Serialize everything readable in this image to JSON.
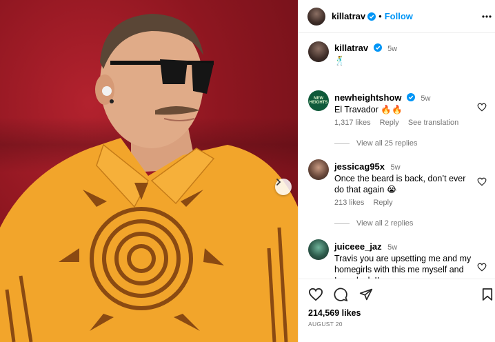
{
  "post": {
    "username": "killatrav",
    "follow_label": "Follow",
    "likes": "214,569 likes",
    "date": "AUGUST 20"
  },
  "caption": {
    "username": "killatrav",
    "time": "5w",
    "text": "🕺"
  },
  "comments": [
    {
      "username": "newheightshow",
      "time": "5w",
      "text": "El Travador 🔥🔥",
      "likes": "1,317 likes",
      "reply_label": "Reply",
      "translate_label": "See translation",
      "view_replies": "View all 25 replies",
      "avatar_text": "NEW HEIGHTS"
    },
    {
      "username": "jessicag95x",
      "time": "5w",
      "text": "Once the beard is back, don’t ever do that again 😭",
      "likes": "213 likes",
      "reply_label": "Reply",
      "view_replies": "View all 2 replies"
    },
    {
      "username": "juiceee_jaz",
      "time": "5w",
      "text": "Travis you are upsetting me and my homegirls with this me myself and Irene look !!"
    }
  ],
  "icons": [
    "verified-badge",
    "heart-icon",
    "comment-icon",
    "share-icon",
    "save-icon",
    "chevron-right-icon"
  ],
  "colors": {
    "follow": "#0095f6",
    "verified": "#0095f6",
    "shirt": "#f2a52b",
    "shirt_pattern": "#8a4a12",
    "background_red": "#a21a26"
  }
}
